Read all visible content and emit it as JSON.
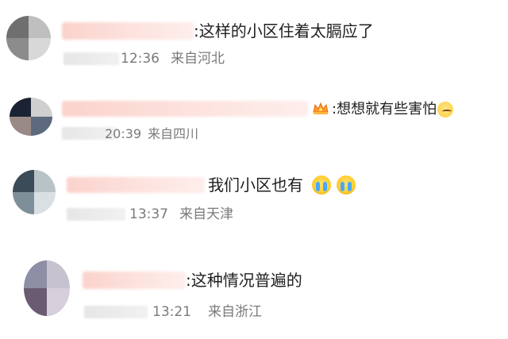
{
  "comments": [
    {
      "text": ":这样的小区住着太膈应了",
      "time": "12:36",
      "location": "来自河北",
      "avatar_colors": [
        "#6f6f6f",
        "#bfbfbf",
        "#8c8c8c",
        "#d8d8d8"
      ]
    },
    {
      "text": ":想想就有些害怕",
      "time": "20:39",
      "location": "来自四川",
      "avatar_colors": [
        "#1b2233",
        "#cfcfcf",
        "#9a8a87",
        "#5d6a7e"
      ]
    },
    {
      "text": "我们小区也有",
      "time": "13:37",
      "location": "来自天津",
      "avatar_colors": [
        "#3b4b57",
        "#b8c3c7",
        "#7e8f99",
        "#d9e0e4"
      ]
    },
    {
      "text": ":这种情况普遍的",
      "time": "13:21",
      "location": "来自浙江",
      "avatar_colors": [
        "#8e8fa6",
        "#c7c2cf",
        "#6b5b72",
        "#d6cfdc"
      ]
    }
  ],
  "icons": {
    "crown_badge": "crown-icon",
    "sweat_emoji": "sweat-smile-emoji-icon",
    "crying_emoji": "crying-face-emoji-icon"
  }
}
